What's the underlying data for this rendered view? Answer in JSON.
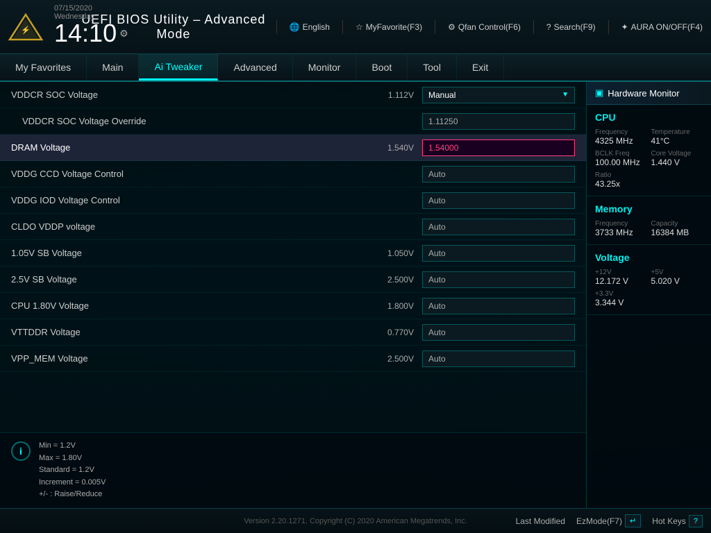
{
  "header": {
    "title": "UEFI BIOS Utility – Advanced Mode",
    "date": "07/15/2020",
    "day": "Wednesday",
    "time": "14:10",
    "toolbar": {
      "language": "English",
      "my_favorite": "MyFavorite(F3)",
      "qfan": "Qfan Control(F6)",
      "search": "Search(F9)",
      "aura": "AURA ON/OFF(F4)"
    }
  },
  "navbar": {
    "items": [
      {
        "id": "my-favorites",
        "label": "My Favorites"
      },
      {
        "id": "main",
        "label": "Main"
      },
      {
        "id": "ai-tweaker",
        "label": "Ai Tweaker",
        "active": true
      },
      {
        "id": "advanced",
        "label": "Advanced"
      },
      {
        "id": "monitor",
        "label": "Monitor"
      },
      {
        "id": "boot",
        "label": "Boot"
      },
      {
        "id": "tool",
        "label": "Tool"
      },
      {
        "id": "exit",
        "label": "Exit"
      }
    ]
  },
  "settings": {
    "rows": [
      {
        "id": "vddcr-soc-voltage",
        "label": "VDDCR SOC Voltage",
        "value": "1.112V",
        "control_type": "dropdown",
        "control_value": "Manual"
      },
      {
        "id": "vddcr-soc-override",
        "label": "VDDCR SOC Voltage Override",
        "value": "",
        "control_type": "text",
        "control_value": "1.11250",
        "indented": true
      },
      {
        "id": "dram-voltage",
        "label": "DRAM Voltage",
        "value": "1.540V",
        "control_type": "text-active",
        "control_value": "1.54000",
        "selected": true
      },
      {
        "id": "vddg-ccd",
        "label": "VDDG CCD Voltage Control",
        "value": "",
        "control_type": "text",
        "control_value": "Auto"
      },
      {
        "id": "vddg-iod",
        "label": "VDDG IOD Voltage Control",
        "value": "",
        "control_type": "text",
        "control_value": "Auto"
      },
      {
        "id": "cldo-vddp",
        "label": "CLDO VDDP voltage",
        "value": "",
        "control_type": "text",
        "control_value": "Auto"
      },
      {
        "id": "1v05-sb",
        "label": "1.05V SB Voltage",
        "value": "1.050V",
        "control_type": "text",
        "control_value": "Auto"
      },
      {
        "id": "2v5-sb",
        "label": "2.5V SB Voltage",
        "value": "2.500V",
        "control_type": "text",
        "control_value": "Auto"
      },
      {
        "id": "cpu-1v8",
        "label": "CPU 1.80V Voltage",
        "value": "1.800V",
        "control_type": "text",
        "control_value": "Auto"
      },
      {
        "id": "vttddr",
        "label": "VTTDDR Voltage",
        "value": "0.770V",
        "control_type": "text",
        "control_value": "Auto"
      },
      {
        "id": "vpp-mem",
        "label": "VPP_MEM Voltage",
        "value": "2.500V",
        "control_type": "text",
        "control_value": "Auto"
      }
    ]
  },
  "info_box": {
    "lines": [
      "Min    = 1.2V",
      "Max    = 1.80V",
      "Standard  = 1.2V",
      "Increment = 0.005V",
      "+/- : Raise/Reduce"
    ]
  },
  "hardware_monitor": {
    "title": "Hardware Monitor",
    "cpu": {
      "section_title": "CPU",
      "frequency_label": "Frequency",
      "frequency_value": "4325 MHz",
      "temperature_label": "Temperature",
      "temperature_value": "41°C",
      "bclk_label": "BCLK Freq",
      "bclk_value": "100.00 MHz",
      "core_voltage_label": "Core Voltage",
      "core_voltage_value": "1.440 V",
      "ratio_label": "Ratio",
      "ratio_value": "43.25x"
    },
    "memory": {
      "section_title": "Memory",
      "frequency_label": "Frequency",
      "frequency_value": "3733 MHz",
      "capacity_label": "Capacity",
      "capacity_value": "16384 MB"
    },
    "voltage": {
      "section_title": "Voltage",
      "v12_label": "+12V",
      "v12_value": "12.172 V",
      "v5_label": "+5V",
      "v5_value": "5.020 V",
      "v33_label": "+3.3V",
      "v33_value": "3.344 V"
    }
  },
  "footer": {
    "last_modified": "Last Modified",
    "ez_mode": "EzMode(F7)",
    "hot_keys": "Hot Keys",
    "version": "Version 2.20.1271. Copyright (C) 2020 American Megatrends, Inc."
  }
}
